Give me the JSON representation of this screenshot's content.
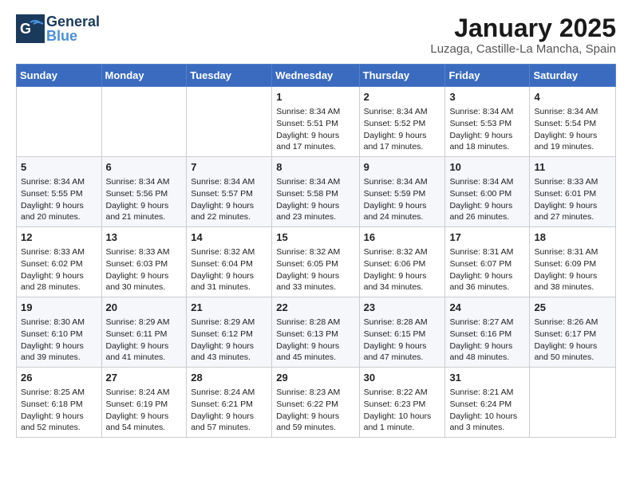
{
  "header": {
    "logo_general": "General",
    "logo_blue": "Blue",
    "title": "January 2025",
    "subtitle": "Luzaga, Castille-La Mancha, Spain"
  },
  "weekdays": [
    "Sunday",
    "Monday",
    "Tuesday",
    "Wednesday",
    "Thursday",
    "Friday",
    "Saturday"
  ],
  "weeks": [
    [
      {
        "num": "",
        "info": ""
      },
      {
        "num": "",
        "info": ""
      },
      {
        "num": "",
        "info": ""
      },
      {
        "num": "1",
        "info": "Sunrise: 8:34 AM\nSunset: 5:51 PM\nDaylight: 9 hours\nand 17 minutes."
      },
      {
        "num": "2",
        "info": "Sunrise: 8:34 AM\nSunset: 5:52 PM\nDaylight: 9 hours\nand 17 minutes."
      },
      {
        "num": "3",
        "info": "Sunrise: 8:34 AM\nSunset: 5:53 PM\nDaylight: 9 hours\nand 18 minutes."
      },
      {
        "num": "4",
        "info": "Sunrise: 8:34 AM\nSunset: 5:54 PM\nDaylight: 9 hours\nand 19 minutes."
      }
    ],
    [
      {
        "num": "5",
        "info": "Sunrise: 8:34 AM\nSunset: 5:55 PM\nDaylight: 9 hours\nand 20 minutes."
      },
      {
        "num": "6",
        "info": "Sunrise: 8:34 AM\nSunset: 5:56 PM\nDaylight: 9 hours\nand 21 minutes."
      },
      {
        "num": "7",
        "info": "Sunrise: 8:34 AM\nSunset: 5:57 PM\nDaylight: 9 hours\nand 22 minutes."
      },
      {
        "num": "8",
        "info": "Sunrise: 8:34 AM\nSunset: 5:58 PM\nDaylight: 9 hours\nand 23 minutes."
      },
      {
        "num": "9",
        "info": "Sunrise: 8:34 AM\nSunset: 5:59 PM\nDaylight: 9 hours\nand 24 minutes."
      },
      {
        "num": "10",
        "info": "Sunrise: 8:34 AM\nSunset: 6:00 PM\nDaylight: 9 hours\nand 26 minutes."
      },
      {
        "num": "11",
        "info": "Sunrise: 8:33 AM\nSunset: 6:01 PM\nDaylight: 9 hours\nand 27 minutes."
      }
    ],
    [
      {
        "num": "12",
        "info": "Sunrise: 8:33 AM\nSunset: 6:02 PM\nDaylight: 9 hours\nand 28 minutes."
      },
      {
        "num": "13",
        "info": "Sunrise: 8:33 AM\nSunset: 6:03 PM\nDaylight: 9 hours\nand 30 minutes."
      },
      {
        "num": "14",
        "info": "Sunrise: 8:32 AM\nSunset: 6:04 PM\nDaylight: 9 hours\nand 31 minutes."
      },
      {
        "num": "15",
        "info": "Sunrise: 8:32 AM\nSunset: 6:05 PM\nDaylight: 9 hours\nand 33 minutes."
      },
      {
        "num": "16",
        "info": "Sunrise: 8:32 AM\nSunset: 6:06 PM\nDaylight: 9 hours\nand 34 minutes."
      },
      {
        "num": "17",
        "info": "Sunrise: 8:31 AM\nSunset: 6:07 PM\nDaylight: 9 hours\nand 36 minutes."
      },
      {
        "num": "18",
        "info": "Sunrise: 8:31 AM\nSunset: 6:09 PM\nDaylight: 9 hours\nand 38 minutes."
      }
    ],
    [
      {
        "num": "19",
        "info": "Sunrise: 8:30 AM\nSunset: 6:10 PM\nDaylight: 9 hours\nand 39 minutes."
      },
      {
        "num": "20",
        "info": "Sunrise: 8:29 AM\nSunset: 6:11 PM\nDaylight: 9 hours\nand 41 minutes."
      },
      {
        "num": "21",
        "info": "Sunrise: 8:29 AM\nSunset: 6:12 PM\nDaylight: 9 hours\nand 43 minutes."
      },
      {
        "num": "22",
        "info": "Sunrise: 8:28 AM\nSunset: 6:13 PM\nDaylight: 9 hours\nand 45 minutes."
      },
      {
        "num": "23",
        "info": "Sunrise: 8:28 AM\nSunset: 6:15 PM\nDaylight: 9 hours\nand 47 minutes."
      },
      {
        "num": "24",
        "info": "Sunrise: 8:27 AM\nSunset: 6:16 PM\nDaylight: 9 hours\nand 48 minutes."
      },
      {
        "num": "25",
        "info": "Sunrise: 8:26 AM\nSunset: 6:17 PM\nDaylight: 9 hours\nand 50 minutes."
      }
    ],
    [
      {
        "num": "26",
        "info": "Sunrise: 8:25 AM\nSunset: 6:18 PM\nDaylight: 9 hours\nand 52 minutes."
      },
      {
        "num": "27",
        "info": "Sunrise: 8:24 AM\nSunset: 6:19 PM\nDaylight: 9 hours\nand 54 minutes."
      },
      {
        "num": "28",
        "info": "Sunrise: 8:24 AM\nSunset: 6:21 PM\nDaylight: 9 hours\nand 57 minutes."
      },
      {
        "num": "29",
        "info": "Sunrise: 8:23 AM\nSunset: 6:22 PM\nDaylight: 9 hours\nand 59 minutes."
      },
      {
        "num": "30",
        "info": "Sunrise: 8:22 AM\nSunset: 6:23 PM\nDaylight: 10 hours\nand 1 minute."
      },
      {
        "num": "31",
        "info": "Sunrise: 8:21 AM\nSunset: 6:24 PM\nDaylight: 10 hours\nand 3 minutes."
      },
      {
        "num": "",
        "info": ""
      }
    ]
  ]
}
